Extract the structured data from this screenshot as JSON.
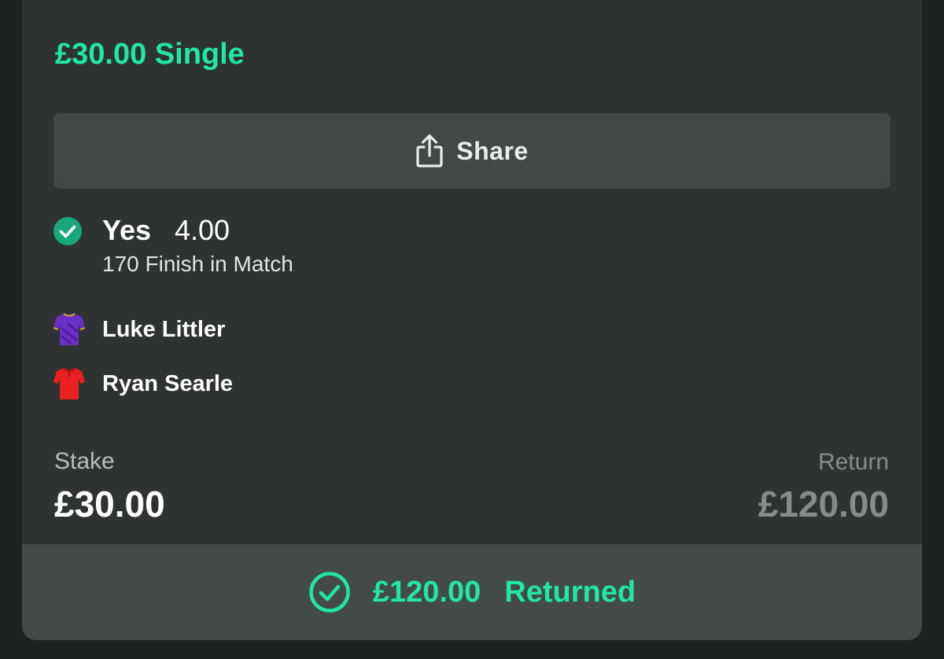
{
  "bet": {
    "title": "£30.00 Single",
    "share_label": "Share",
    "selection": {
      "name": "Yes",
      "odds": "4.00",
      "market": "170 Finish in Match"
    },
    "players": [
      {
        "name": "Luke Littler",
        "shirt_color": "#6a2fc4",
        "icon": "purple-shirt-icon"
      },
      {
        "name": "Ryan Searle",
        "shirt_color": "#e82020",
        "icon": "red-shirt-icon"
      }
    ],
    "stake_label": "Stake",
    "stake_value": "£30.00",
    "return_label": "Return",
    "return_value": "£120.00",
    "footer": {
      "amount": "£120.00",
      "status": "Returned"
    }
  },
  "colors": {
    "accent": "#20e6a6",
    "card_bg": "#2e3332",
    "button_bg": "#414846",
    "footer_bg": "#444a48",
    "check_bg": "#16a77a"
  }
}
